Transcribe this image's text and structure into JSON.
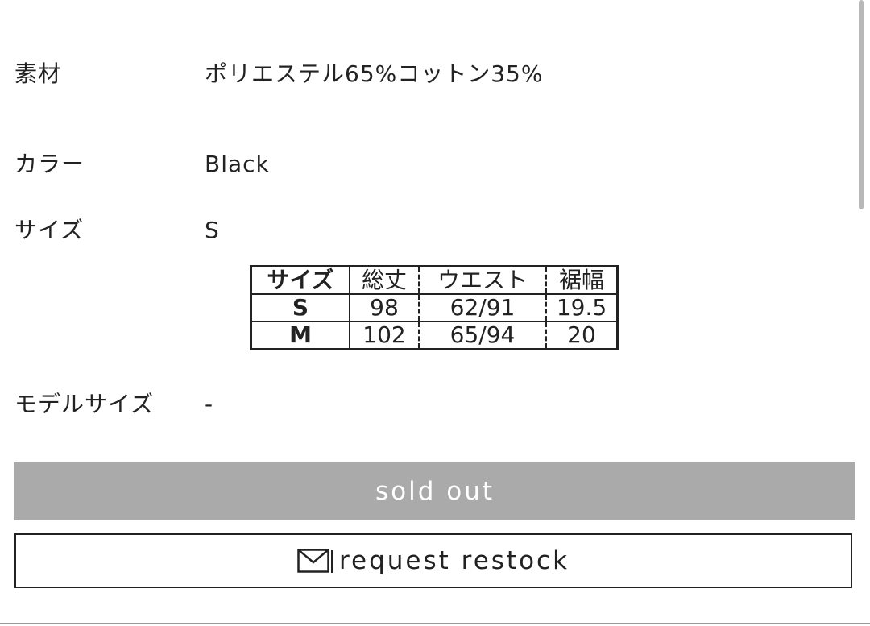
{
  "specs": {
    "material": {
      "label": "素材",
      "value": "ポリエステル65%コットン35%"
    },
    "color": {
      "label": "カラー",
      "value": "Black"
    },
    "size": {
      "label": "サイズ",
      "value": "S"
    },
    "model_size": {
      "label": "モデルサイズ",
      "value": "-"
    }
  },
  "size_table": {
    "headers": [
      "サイズ",
      "総丈",
      "ウエスト",
      "裾幅"
    ],
    "rows": [
      [
        "S",
        "98",
        "62/91",
        "19.5"
      ],
      [
        "M",
        "102",
        "65/94",
        "20"
      ]
    ]
  },
  "buttons": {
    "sold_out_label": "sold out",
    "restock_label": "request restock"
  },
  "icons": {
    "restock_icon": "mail-icon"
  },
  "colors": {
    "sold_out_bg": "#aaaaaa",
    "text": "#222222"
  }
}
